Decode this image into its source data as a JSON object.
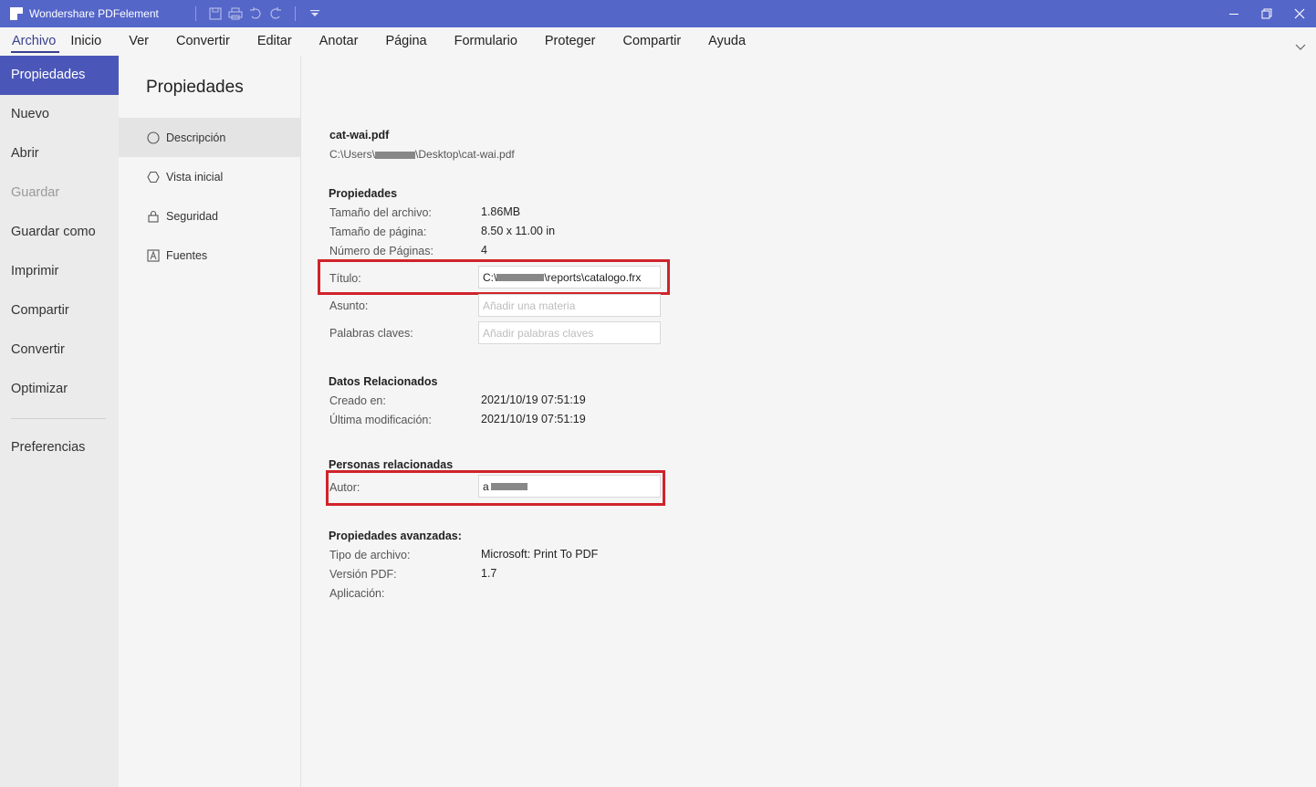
{
  "app": {
    "title": "Wondershare PDFelement",
    "accent": "#5566c9",
    "highlight_color": "#d0232b"
  },
  "menu": {
    "items": [
      "Archivo",
      "Inicio",
      "Ver",
      "Convertir",
      "Editar",
      "Anotar",
      "Página",
      "Formulario",
      "Proteger",
      "Compartir",
      "Ayuda"
    ]
  },
  "leftnav": {
    "items": [
      {
        "label": "Propiedades",
        "state": "active"
      },
      {
        "label": "Nuevo",
        "state": "normal"
      },
      {
        "label": "Abrir",
        "state": "normal"
      },
      {
        "label": "Guardar",
        "state": "disabled"
      },
      {
        "label": "Guardar como",
        "state": "normal"
      },
      {
        "label": "Imprimir",
        "state": "normal"
      },
      {
        "label": "Compartir",
        "state": "normal"
      },
      {
        "label": "Convertir",
        "state": "normal"
      },
      {
        "label": "Optimizar",
        "state": "normal"
      }
    ],
    "preferences": "Preferencias"
  },
  "midpane": {
    "title": "Propiedades",
    "items": [
      {
        "label": "Descripción",
        "icon": "circle-icon",
        "active": true
      },
      {
        "label": "Vista inicial",
        "icon": "hexagon-icon",
        "active": false
      },
      {
        "label": "Seguridad",
        "icon": "lock-icon",
        "active": false
      },
      {
        "label": "Fuentes",
        "icon": "font-icon",
        "active": false
      }
    ]
  },
  "file": {
    "name": "cat-wai.pdf",
    "path_start": "C:\\Users\\",
    "path_end": "\\Desktop\\cat-wai.pdf"
  },
  "properties": {
    "heading": "Propiedades",
    "file_size_label": "Tamaño del archivo:",
    "file_size_value": "1.86MB",
    "page_size_label": "Tamaño de página:",
    "page_size_value": "8.50 x 11.00 in",
    "page_count_label": "Número de Páginas:",
    "page_count_value": "4",
    "title_label": "Título:",
    "title_value_start": "C:\\",
    "title_value_end": "\\reports\\catalogo.frx",
    "subject_label": "Asunto:",
    "subject_placeholder": "Añadir una materia",
    "keywords_label": "Palabras claves:",
    "keywords_placeholder": "Añadir palabras claves"
  },
  "dates": {
    "heading": "Datos Relacionados",
    "created_label": "Creado en:",
    "created_value": "2021/10/19 07:51:19",
    "modified_label": "Última modificación:",
    "modified_value": "2021/10/19 07:51:19"
  },
  "people": {
    "heading": "Personas relacionadas",
    "author_label": "Autor:",
    "author_value_start": "a"
  },
  "advanced": {
    "heading": "Propiedades avanzadas:",
    "file_type_label": "Tipo de archivo:",
    "file_type_value": "Microsoft: Print To PDF",
    "pdf_version_label": "Versión PDF:",
    "pdf_version_value": "1.7",
    "application_label": "Aplicación:"
  }
}
